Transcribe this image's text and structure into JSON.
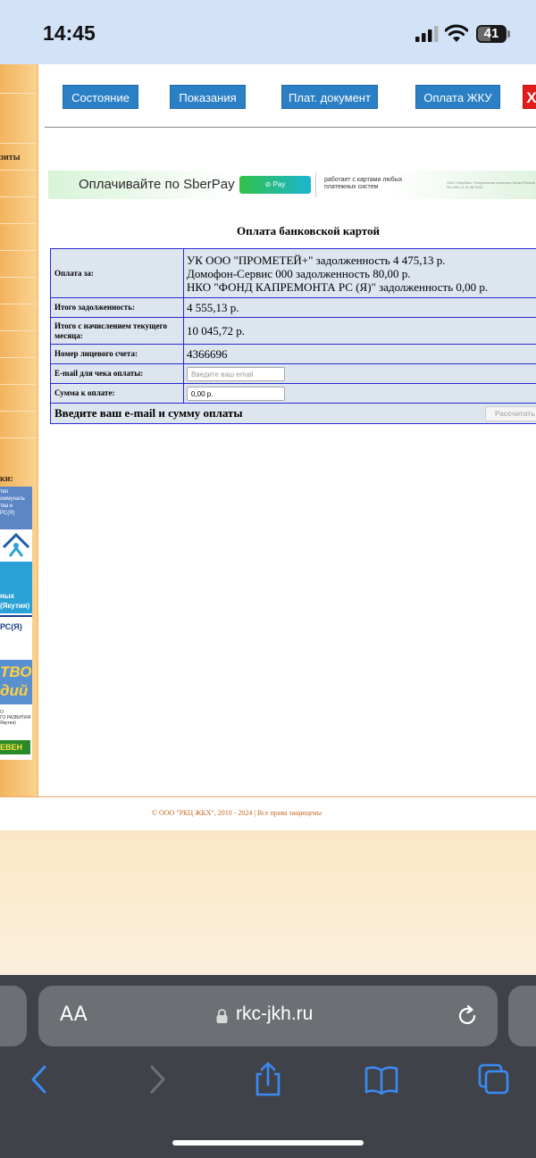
{
  "status_bar": {
    "time": "14:45",
    "battery": "41"
  },
  "sidebar": {
    "menu_fragment": "зиты",
    "links_fragment": "ки:",
    "banner_texts": {
      "b1": "тво\nоммуналь\nтва и\nРС(Я)",
      "b3": "ных\n(Якутия)",
      "b4": "РС(Я)",
      "b5": "ТВО\nдий",
      "b6": "О\nГО РАЗВИТИЯ\nЯкутия)",
      "b7": "ЕВЕН"
    }
  },
  "nav": {
    "state": "Состояние",
    "readings": "Показания",
    "pay_doc": "Плат. документ",
    "pay_zhku": "Оплата ЖКУ",
    "exit": "X"
  },
  "sber_banner": {
    "title": "Оплачивайте по SberPay",
    "pay_button": "Pay",
    "cards": "работает с картами любых платежных систем",
    "legal": "ПАО Сбербанк. Генеральная лицензия Банка России № 1481 от 11.08.2015"
  },
  "payment": {
    "title": "Оплата банковской картой",
    "pay_for_label": "Оплата за:",
    "pay_for_items": [
      "УК ООО \"ПРОМЕТЕЙ+\" задолженность 4 475,13 р.",
      "Домофон-Сервис 000 задолженность 80,00 р.",
      "НКО \"ФОНД КАПРЕМОНТА РС (Я)\" задолженность 0,00 р."
    ],
    "total_debt_label": "Итого задолженность:",
    "total_debt_value": "4 555,13 р.",
    "total_with_month_label": "Итого с начислением текущего месяца:",
    "total_with_month_value": "10 045,72 р.",
    "account_label": "Номер лицевого счета:",
    "account_value": "4366696",
    "email_label": "E-mail для чека оплаты:",
    "email_placeholder": "Введите ваш email",
    "amount_label": "Сумма к оплате:",
    "amount_value": "0,00 р.",
    "prompt": "Введите ваш e-mail и сумму оплаты",
    "calc_button": "Рассчитать"
  },
  "footer": {
    "text": "© ООО \"РКЦ ЖКХ\", 2010 - 2024 | Все права защищены"
  },
  "browser": {
    "text_size": "AA",
    "url": "rkc-jkh.ru"
  }
}
